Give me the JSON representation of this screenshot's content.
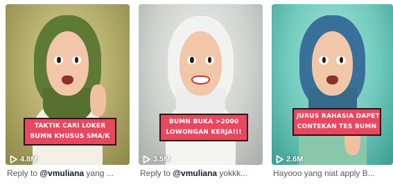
{
  "videos": [
    {
      "caption": [
        "TAKTIK CARI LOKER",
        "BUMN KHUSUS SMA/K"
      ],
      "views": "4.8M",
      "reply": {
        "prefix": "Reply to ",
        "mention": "@vmuliana",
        "suffix": " yang ..."
      }
    },
    {
      "caption": [
        "BUMN BUKA >2000",
        "LOWONGAN KERJA!!!"
      ],
      "views": "3.5M",
      "reply": {
        "prefix": "Reply to ",
        "mention": "@vmuliana",
        "suffix": " yokkk..."
      }
    },
    {
      "caption": [
        "JURUS RAHASIA DAPET",
        "CONTEKAN TES BUMN"
      ],
      "views": "2.6M",
      "reply": {
        "prefix": "Hayooo yang niat apply B...",
        "mention": "",
        "suffix": ""
      }
    }
  ],
  "colors": {
    "badge": "#e8485f",
    "badge_border": "#2e0f12",
    "mention": "#161823",
    "reply_text": "#555555"
  },
  "icons": {
    "views": "play-icon"
  }
}
